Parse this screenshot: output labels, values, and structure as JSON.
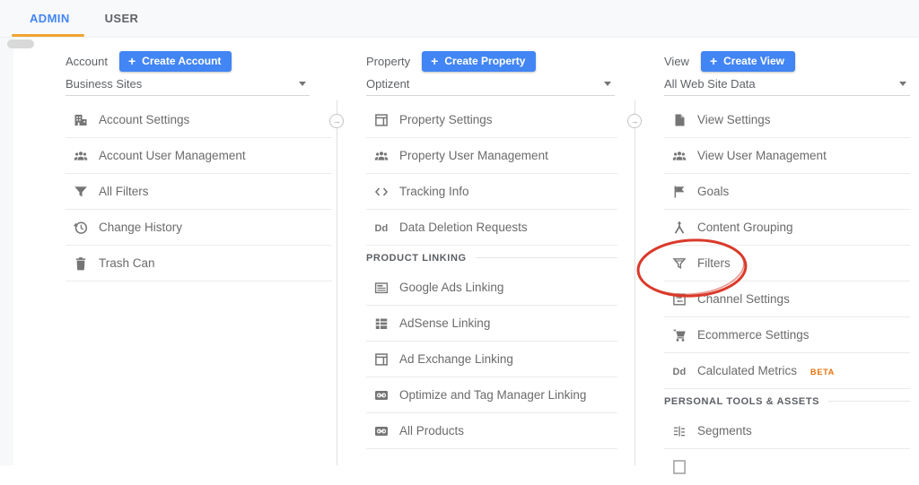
{
  "tabs": [
    {
      "label": "ADMIN",
      "active": true
    },
    {
      "label": "USER",
      "active": false
    }
  ],
  "ui": {
    "plus": "+",
    "collapse_arrow": "→",
    "accent_blue": "#4285f4",
    "accent_orange": "#f0a431",
    "annotation_red": "#d93a2b",
    "beta_orange": "#e8710a"
  },
  "columns": [
    {
      "label": "Account",
      "create_button": "Create Account",
      "selected_value": "Business Sites",
      "groups": [
        {
          "header": "",
          "items": [
            {
              "icon": "building-icon",
              "label": "Account Settings"
            },
            {
              "icon": "people-icon",
              "label": "Account User Management"
            },
            {
              "icon": "funnel-icon",
              "label": "All Filters"
            },
            {
              "icon": "history-icon",
              "label": "Change History"
            },
            {
              "icon": "trash-icon",
              "label": "Trash Can"
            }
          ]
        }
      ]
    },
    {
      "label": "Property",
      "create_button": "Create Property",
      "selected_value": "Optizent",
      "groups": [
        {
          "header": "",
          "items": [
            {
              "icon": "window-icon",
              "label": "Property Settings"
            },
            {
              "icon": "people-icon",
              "label": "Property User Management"
            },
            {
              "icon": "code-icon",
              "label": "Tracking Info"
            },
            {
              "icon": "dd-icon",
              "label": "Data Deletion Requests"
            }
          ]
        },
        {
          "header": "PRODUCT LINKING",
          "items": [
            {
              "icon": "ads-lines-icon",
              "label": "Google Ads Linking"
            },
            {
              "icon": "table-icon",
              "label": "AdSense Linking"
            },
            {
              "icon": "window-icon",
              "label": "Ad Exchange Linking"
            },
            {
              "icon": "link-icon",
              "label": "Optimize and Tag Manager Linking"
            },
            {
              "icon": "link-icon",
              "label": "All Products"
            }
          ]
        }
      ]
    },
    {
      "label": "View",
      "create_button": "Create View",
      "selected_value": "All Web Site Data",
      "groups": [
        {
          "header": "",
          "items": [
            {
              "icon": "page-icon",
              "label": "View Settings"
            },
            {
              "icon": "people-icon",
              "label": "View User Management"
            },
            {
              "icon": "flag-icon",
              "label": "Goals"
            },
            {
              "icon": "split-icon",
              "label": "Content Grouping"
            },
            {
              "icon": "funnel-outline-icon",
              "label": "Filters",
              "circled": true
            },
            {
              "icon": "channel-icon",
              "label": "Channel Settings"
            },
            {
              "icon": "cart-icon",
              "label": "Ecommerce Settings"
            },
            {
              "icon": "dd-icon",
              "label": "Calculated Metrics",
              "badge": "BETA"
            }
          ]
        },
        {
          "header": "PERSONAL TOOLS & ASSETS",
          "items": [
            {
              "icon": "segments-icon",
              "label": "Segments"
            },
            {
              "icon": "partial-square-icon",
              "label": ""
            }
          ]
        }
      ]
    }
  ]
}
